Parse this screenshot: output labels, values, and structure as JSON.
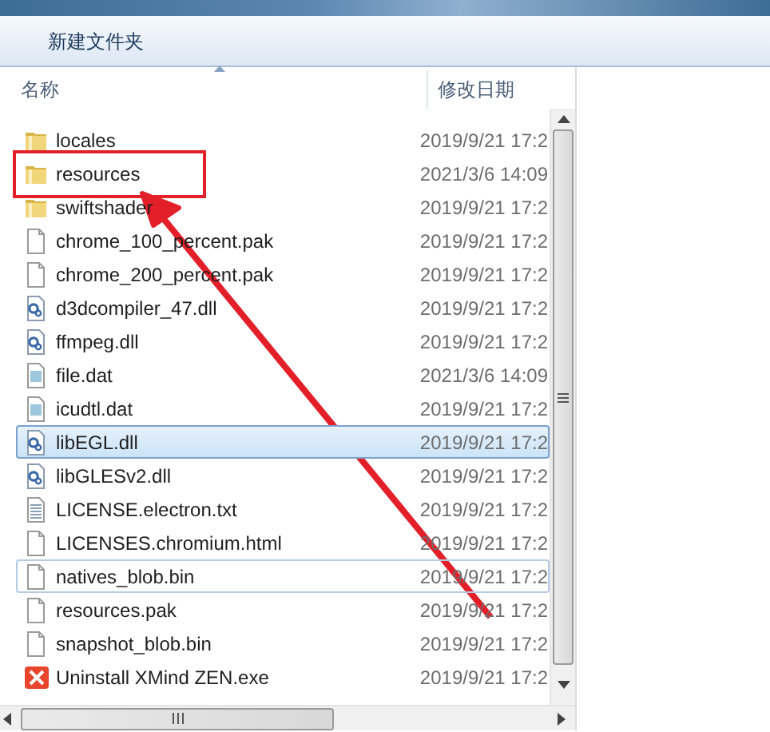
{
  "toolbar": {
    "buttons": [
      "新建文件夹"
    ]
  },
  "columns": [
    {
      "label": "名称",
      "sorted": true
    },
    {
      "label": "修改日期",
      "sorted": false
    }
  ],
  "rows": [
    {
      "name": "locales",
      "date": "2019/9/21 17:2",
      "kind": "folder",
      "selected": false,
      "focused": false,
      "highlighted": false
    },
    {
      "name": "resources",
      "date": "2021/3/6 14:09",
      "kind": "folder",
      "selected": false,
      "focused": false,
      "highlighted": true
    },
    {
      "name": "swiftshader",
      "date": "2019/9/21 17:2",
      "kind": "folder",
      "selected": false,
      "focused": false,
      "highlighted": false
    },
    {
      "name": "chrome_100_percent.pak",
      "date": "2019/9/21 17:2",
      "kind": "file",
      "selected": false,
      "focused": false,
      "highlighted": false
    },
    {
      "name": "chrome_200_percent.pak",
      "date": "2019/9/21 17:2",
      "kind": "file",
      "selected": false,
      "focused": false,
      "highlighted": false
    },
    {
      "name": "d3dcompiler_47.dll",
      "date": "2019/9/21 17:2",
      "kind": "dll",
      "selected": false,
      "focused": false,
      "highlighted": false
    },
    {
      "name": "ffmpeg.dll",
      "date": "2019/9/21 17:2",
      "kind": "dll",
      "selected": false,
      "focused": false,
      "highlighted": false
    },
    {
      "name": "file.dat",
      "date": "2021/3/6 14:09",
      "kind": "dat",
      "selected": false,
      "focused": false,
      "highlighted": false
    },
    {
      "name": "icudtl.dat",
      "date": "2019/9/21 17:2",
      "kind": "dat",
      "selected": false,
      "focused": false,
      "highlighted": false
    },
    {
      "name": "libEGL.dll",
      "date": "2019/9/21 17:2",
      "kind": "dll",
      "selected": true,
      "focused": false,
      "highlighted": false
    },
    {
      "name": "libGLESv2.dll",
      "date": "2019/9/21 17:2",
      "kind": "dll",
      "selected": false,
      "focused": false,
      "highlighted": false
    },
    {
      "name": "LICENSE.electron.txt",
      "date": "2019/9/21 17:2",
      "kind": "txt",
      "selected": false,
      "focused": false,
      "highlighted": false
    },
    {
      "name": "LICENSES.chromium.html",
      "date": "2019/9/21 17:2",
      "kind": "file",
      "selected": false,
      "focused": false,
      "highlighted": false
    },
    {
      "name": "natives_blob.bin",
      "date": "2019/9/21 17:2",
      "kind": "file",
      "selected": false,
      "focused": true,
      "highlighted": false
    },
    {
      "name": "resources.pak",
      "date": "2019/9/21 17:2",
      "kind": "file",
      "selected": false,
      "focused": false,
      "highlighted": false
    },
    {
      "name": "snapshot_blob.bin",
      "date": "2019/9/21 17:2",
      "kind": "file",
      "selected": false,
      "focused": false,
      "highlighted": false
    },
    {
      "name": "Uninstall XMind ZEN.exe",
      "date": "2019/9/21 17:2",
      "kind": "exe",
      "selected": false,
      "focused": false,
      "highlighted": false
    }
  ]
}
